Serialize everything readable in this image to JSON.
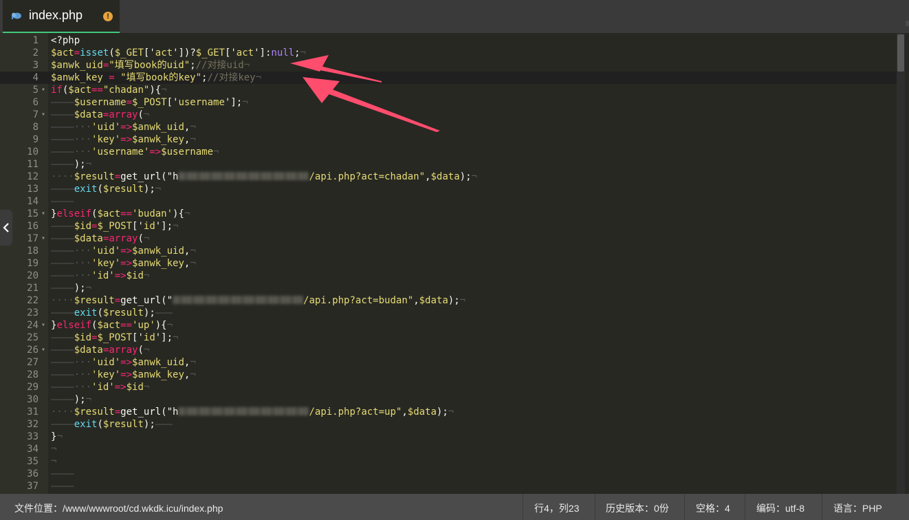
{
  "tab": {
    "title": "index.php",
    "warning_badge": "!"
  },
  "editor": {
    "lines": [
      {
        "n": "1",
        "fold": false,
        "code": [
          [
            "t-pun",
            "<?php"
          ]
        ]
      },
      {
        "n": "2",
        "fold": false,
        "code": [
          [
            "t-var",
            "$act"
          ],
          [
            "t-kw",
            "="
          ],
          [
            "t-fn",
            "isset"
          ],
          [
            "t-pun",
            "("
          ],
          [
            "t-var",
            "$_GET"
          ],
          [
            "t-pun",
            "['"
          ],
          [
            "t-str",
            "act"
          ],
          [
            "t-pun",
            "'])?"
          ],
          [
            "t-var",
            "$_GET"
          ],
          [
            "t-pun",
            "['"
          ],
          [
            "t-str",
            "act"
          ],
          [
            "t-pun",
            "']:"
          ],
          [
            "t-null",
            "null"
          ],
          [
            "t-pun",
            ";"
          ],
          [
            "t-ws",
            "¬"
          ]
        ]
      },
      {
        "n": "3",
        "fold": false,
        "code": [
          [
            "t-var",
            "$anwk_uid"
          ],
          [
            "t-kw",
            "="
          ],
          [
            "t-str",
            "\"填写book的uid\""
          ],
          [
            "t-pun",
            ";"
          ],
          [
            "t-com",
            "//对接uid"
          ],
          [
            "t-ws",
            "¬"
          ]
        ]
      },
      {
        "n": "4",
        "fold": false,
        "active": true,
        "code": [
          [
            "t-var",
            "$anwk_key"
          ],
          [
            "t-pun",
            " "
          ],
          [
            "t-kw",
            "="
          ],
          [
            "t-pun",
            " "
          ],
          [
            "t-str",
            "\"填写book的key\""
          ],
          [
            "t-pun",
            ";"
          ],
          [
            "t-com",
            "//对接key"
          ],
          [
            "t-ws",
            "¬"
          ]
        ]
      },
      {
        "n": "5",
        "fold": true,
        "code": [
          [
            "t-kw",
            "if"
          ],
          [
            "t-pun",
            "("
          ],
          [
            "t-var",
            "$act"
          ],
          [
            "t-kw",
            "=="
          ],
          [
            "t-str",
            "\"chadan\""
          ],
          [
            "t-pun",
            "){"
          ],
          [
            "t-ws",
            "¬"
          ]
        ]
      },
      {
        "n": "6",
        "fold": false,
        "code": [
          [
            "t-ws",
            "————"
          ],
          [
            "t-var",
            "$username"
          ],
          [
            "t-kw",
            "="
          ],
          [
            "t-var",
            "$_POST"
          ],
          [
            "t-pun",
            "['"
          ],
          [
            "t-str",
            "username"
          ],
          [
            "t-pun",
            "'];"
          ],
          [
            "t-ws",
            "¬"
          ]
        ]
      },
      {
        "n": "7",
        "fold": true,
        "code": [
          [
            "t-ws",
            "————"
          ],
          [
            "t-var",
            "$data"
          ],
          [
            "t-kw",
            "="
          ],
          [
            "t-kw",
            "array"
          ],
          [
            "t-pun",
            "("
          ],
          [
            "t-ws",
            "¬"
          ]
        ]
      },
      {
        "n": "8",
        "fold": false,
        "code": [
          [
            "t-ws",
            "————···"
          ],
          [
            "t-str",
            "'uid'"
          ],
          [
            "t-kw",
            "=>"
          ],
          [
            "t-var",
            "$anwk_uid"
          ],
          [
            "t-pun",
            ","
          ],
          [
            "t-ws",
            "¬"
          ]
        ]
      },
      {
        "n": "9",
        "fold": false,
        "code": [
          [
            "t-ws",
            "————···"
          ],
          [
            "t-str",
            "'key'"
          ],
          [
            "t-kw",
            "=>"
          ],
          [
            "t-var",
            "$anwk_key"
          ],
          [
            "t-pun",
            ","
          ],
          [
            "t-ws",
            "¬"
          ]
        ]
      },
      {
        "n": "10",
        "fold": false,
        "code": [
          [
            "t-ws",
            "————···"
          ],
          [
            "t-str",
            "'username'"
          ],
          [
            "t-kw",
            "=>"
          ],
          [
            "t-var",
            "$username"
          ],
          [
            "t-ws",
            "¬"
          ]
        ]
      },
      {
        "n": "11",
        "fold": false,
        "code": [
          [
            "t-ws",
            "————"
          ],
          [
            "t-pun",
            ");"
          ],
          [
            "t-ws",
            "¬"
          ]
        ]
      },
      {
        "n": "12",
        "fold": false,
        "code": [
          [
            "t-ws",
            "····"
          ],
          [
            "t-var",
            "$result"
          ],
          [
            "t-kw",
            "="
          ],
          [
            "t-pun",
            "get_url(\"h"
          ],
          [
            "blur",
            ""
          ],
          [
            "t-str",
            "/api.php?act=chadan\""
          ],
          [
            "t-pun",
            ","
          ],
          [
            "t-var",
            "$data"
          ],
          [
            "t-pun",
            ");"
          ],
          [
            "t-ws",
            "¬"
          ]
        ]
      },
      {
        "n": "13",
        "fold": false,
        "code": [
          [
            "t-ws",
            "————"
          ],
          [
            "t-fn",
            "exit"
          ],
          [
            "t-pun",
            "("
          ],
          [
            "t-var",
            "$result"
          ],
          [
            "t-pun",
            ");"
          ],
          [
            "t-ws",
            "¬"
          ]
        ]
      },
      {
        "n": "14",
        "fold": false,
        "code": [
          [
            "t-ws",
            "————"
          ]
        ]
      },
      {
        "n": "15",
        "fold": true,
        "code": [
          [
            "t-pun",
            "}"
          ],
          [
            "t-kw",
            "elseif"
          ],
          [
            "t-pun",
            "("
          ],
          [
            "t-var",
            "$act"
          ],
          [
            "t-kw",
            "=="
          ],
          [
            "t-str",
            "'budan'"
          ],
          [
            "t-pun",
            "){"
          ],
          [
            "t-ws",
            "¬"
          ]
        ]
      },
      {
        "n": "16",
        "fold": false,
        "code": [
          [
            "t-ws",
            "————"
          ],
          [
            "t-var",
            "$id"
          ],
          [
            "t-kw",
            "="
          ],
          [
            "t-var",
            "$_POST"
          ],
          [
            "t-pun",
            "['"
          ],
          [
            "t-str",
            "id"
          ],
          [
            "t-pun",
            "'];"
          ],
          [
            "t-ws",
            "¬"
          ]
        ]
      },
      {
        "n": "17",
        "fold": true,
        "code": [
          [
            "t-ws",
            "————"
          ],
          [
            "t-var",
            "$data"
          ],
          [
            "t-kw",
            "="
          ],
          [
            "t-kw",
            "array"
          ],
          [
            "t-pun",
            "("
          ],
          [
            "t-ws",
            "¬"
          ]
        ]
      },
      {
        "n": "18",
        "fold": false,
        "code": [
          [
            "t-ws",
            "————···"
          ],
          [
            "t-str",
            "'uid'"
          ],
          [
            "t-kw",
            "=>"
          ],
          [
            "t-var",
            "$anwk_uid"
          ],
          [
            "t-pun",
            ","
          ],
          [
            "t-ws",
            "¬"
          ]
        ]
      },
      {
        "n": "19",
        "fold": false,
        "code": [
          [
            "t-ws",
            "————···"
          ],
          [
            "t-str",
            "'key'"
          ],
          [
            "t-kw",
            "=>"
          ],
          [
            "t-var",
            "$anwk_key"
          ],
          [
            "t-pun",
            ","
          ],
          [
            "t-ws",
            "¬"
          ]
        ]
      },
      {
        "n": "20",
        "fold": false,
        "code": [
          [
            "t-ws",
            "————···"
          ],
          [
            "t-str",
            "'id'"
          ],
          [
            "t-kw",
            "=>"
          ],
          [
            "t-var",
            "$id"
          ],
          [
            "t-ws",
            "¬"
          ]
        ]
      },
      {
        "n": "21",
        "fold": false,
        "code": [
          [
            "t-ws",
            "————"
          ],
          [
            "t-pun",
            ");"
          ],
          [
            "t-ws",
            "¬"
          ]
        ]
      },
      {
        "n": "22",
        "fold": false,
        "code": [
          [
            "t-ws",
            "····"
          ],
          [
            "t-var",
            "$result"
          ],
          [
            "t-kw",
            "="
          ],
          [
            "t-pun",
            "get_url(\""
          ],
          [
            "blur",
            ""
          ],
          [
            "t-str",
            "/api.php?act=budan\""
          ],
          [
            "t-pun",
            ","
          ],
          [
            "t-var",
            "$data"
          ],
          [
            "t-pun",
            ");"
          ],
          [
            "t-ws",
            "¬"
          ]
        ]
      },
      {
        "n": "23",
        "fold": false,
        "code": [
          [
            "t-ws",
            "————"
          ],
          [
            "t-fn",
            "exit"
          ],
          [
            "t-pun",
            "("
          ],
          [
            "t-var",
            "$result"
          ],
          [
            "t-pun",
            ");"
          ],
          [
            "t-ws",
            "———"
          ]
        ]
      },
      {
        "n": "24",
        "fold": true,
        "code": [
          [
            "t-pun",
            "}"
          ],
          [
            "t-kw",
            "elseif"
          ],
          [
            "t-pun",
            "("
          ],
          [
            "t-var",
            "$act"
          ],
          [
            "t-kw",
            "=="
          ],
          [
            "t-str",
            "'up'"
          ],
          [
            "t-pun",
            "){"
          ],
          [
            "t-ws",
            "¬"
          ]
        ]
      },
      {
        "n": "25",
        "fold": false,
        "code": [
          [
            "t-ws",
            "————"
          ],
          [
            "t-var",
            "$id"
          ],
          [
            "t-kw",
            "="
          ],
          [
            "t-var",
            "$_POST"
          ],
          [
            "t-pun",
            "['"
          ],
          [
            "t-str",
            "id"
          ],
          [
            "t-pun",
            "'];"
          ],
          [
            "t-ws",
            "¬"
          ]
        ]
      },
      {
        "n": "26",
        "fold": true,
        "code": [
          [
            "t-ws",
            "————"
          ],
          [
            "t-var",
            "$data"
          ],
          [
            "t-kw",
            "="
          ],
          [
            "t-kw",
            "array"
          ],
          [
            "t-pun",
            "("
          ],
          [
            "t-ws",
            "¬"
          ]
        ]
      },
      {
        "n": "27",
        "fold": false,
        "code": [
          [
            "t-ws",
            "————···"
          ],
          [
            "t-str",
            "'uid'"
          ],
          [
            "t-kw",
            "=>"
          ],
          [
            "t-var",
            "$anwk_uid"
          ],
          [
            "t-pun",
            ","
          ],
          [
            "t-ws",
            "¬"
          ]
        ]
      },
      {
        "n": "28",
        "fold": false,
        "code": [
          [
            "t-ws",
            "————···"
          ],
          [
            "t-str",
            "'key'"
          ],
          [
            "t-kw",
            "=>"
          ],
          [
            "t-var",
            "$anwk_key"
          ],
          [
            "t-pun",
            ","
          ],
          [
            "t-ws",
            "¬"
          ]
        ]
      },
      {
        "n": "29",
        "fold": false,
        "code": [
          [
            "t-ws",
            "————···"
          ],
          [
            "t-str",
            "'id'"
          ],
          [
            "t-kw",
            "=>"
          ],
          [
            "t-var",
            "$id"
          ],
          [
            "t-ws",
            "¬"
          ]
        ]
      },
      {
        "n": "30",
        "fold": false,
        "code": [
          [
            "t-ws",
            "————"
          ],
          [
            "t-pun",
            ");"
          ],
          [
            "t-ws",
            "¬"
          ]
        ]
      },
      {
        "n": "31",
        "fold": false,
        "code": [
          [
            "t-ws",
            "····"
          ],
          [
            "t-var",
            "$result"
          ],
          [
            "t-kw",
            "="
          ],
          [
            "t-pun",
            "get_url(\"h"
          ],
          [
            "blur",
            ""
          ],
          [
            "t-str",
            "/api.php?act=up\""
          ],
          [
            "t-pun",
            ","
          ],
          [
            "t-var",
            "$data"
          ],
          [
            "t-pun",
            ");"
          ],
          [
            "t-ws",
            "¬"
          ]
        ]
      },
      {
        "n": "32",
        "fold": false,
        "code": [
          [
            "t-ws",
            "————"
          ],
          [
            "t-fn",
            "exit"
          ],
          [
            "t-pun",
            "("
          ],
          [
            "t-var",
            "$result"
          ],
          [
            "t-pun",
            ");"
          ],
          [
            "t-ws",
            "———"
          ]
        ]
      },
      {
        "n": "33",
        "fold": false,
        "code": [
          [
            "t-pun",
            "}"
          ],
          [
            "t-ws",
            "¬"
          ]
        ]
      },
      {
        "n": "34",
        "fold": false,
        "code": [
          [
            "t-ws",
            "¬"
          ]
        ]
      },
      {
        "n": "35",
        "fold": false,
        "code": [
          [
            "t-ws",
            "¬"
          ]
        ]
      },
      {
        "n": "36",
        "fold": false,
        "code": [
          [
            "t-ws",
            "————"
          ]
        ]
      },
      {
        "n": "37",
        "fold": false,
        "code": [
          [
            "t-ws",
            "————"
          ]
        ]
      }
    ]
  },
  "statusbar": {
    "file_path": "文件位置：/www/wwwroot/cd.wkdk.icu/index.php",
    "cursor": "行4，列23",
    "history": "历史版本：0份",
    "indent": "空格：4",
    "encoding": "编码：utf-8",
    "language": "语言：PHP"
  },
  "colors": {
    "accent": "#43c97a",
    "arrow": "#ff4d6d",
    "warning": "#e6a23c"
  }
}
